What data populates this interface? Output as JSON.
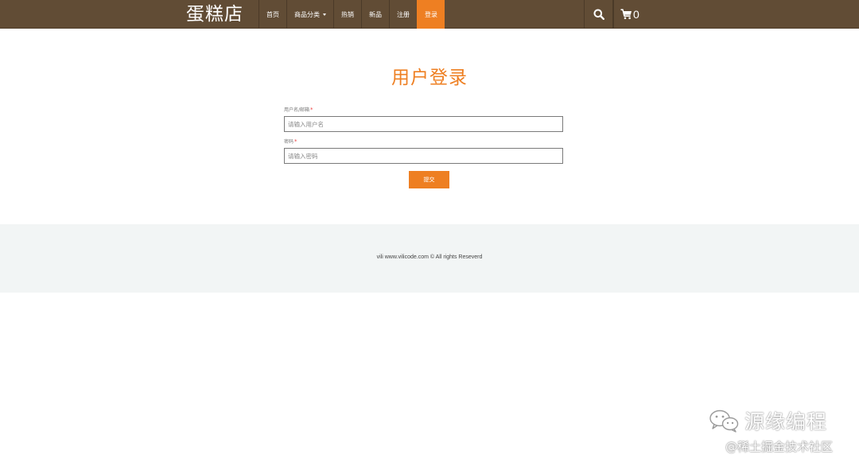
{
  "brand": {
    "name": "蛋糕店"
  },
  "nav": {
    "items": [
      {
        "label": "首页",
        "active": false
      },
      {
        "label": "商品分类",
        "active": false,
        "has_caret": true
      },
      {
        "label": "热销",
        "active": false
      },
      {
        "label": "新品",
        "active": false
      },
      {
        "label": "注册",
        "active": false
      },
      {
        "label": "登录",
        "active": true
      }
    ],
    "search_icon": "search-icon",
    "cart_icon": "cart-icon",
    "cart_count": "0"
  },
  "login": {
    "title": "用户登录",
    "username": {
      "label": "用户名/邮箱",
      "required_mark": "*",
      "placeholder": "请输入用户名",
      "value": ""
    },
    "password": {
      "label": "密码",
      "required_mark": "*",
      "placeholder": "请输入密码",
      "value": ""
    },
    "submit_label": "提交"
  },
  "footer": {
    "text": "vili www.vilicode.com © All rights Reseverd"
  },
  "watermark": {
    "main": "源缘编程",
    "sub": "@稀土掘金技术社区"
  },
  "colors": {
    "nav_bg": "#614c35",
    "accent": "#ee7f22",
    "footer_bg": "#f2f5f5"
  }
}
